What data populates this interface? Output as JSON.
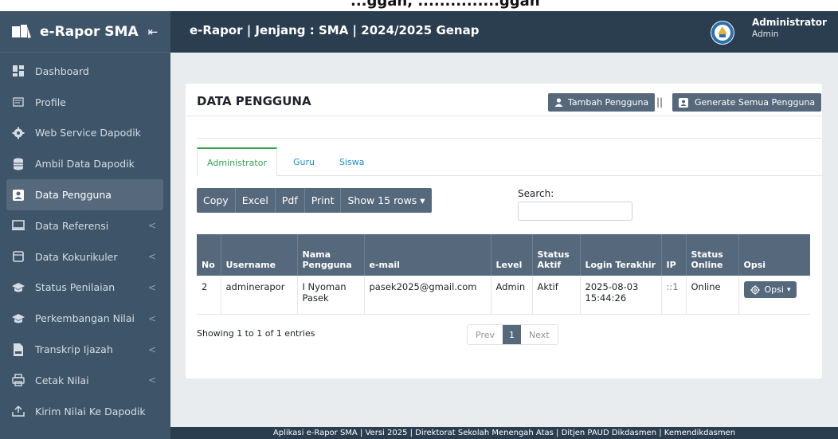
{
  "top_strip": "...ggan, ...............ggan",
  "sidebar": {
    "brand": "e-Rapor SMA",
    "collapse_icon": "⇤",
    "items": [
      {
        "label": "Dashboard",
        "icon": "dashboard-icon",
        "caret": ""
      },
      {
        "label": "Profile",
        "icon": "profile-icon",
        "caret": ""
      },
      {
        "label": "Web Service Dapodik",
        "icon": "gear-icon",
        "caret": ""
      },
      {
        "label": "Ambil Data Dapodik",
        "icon": "database-icon",
        "caret": ""
      },
      {
        "label": "Data Pengguna",
        "icon": "user-card-icon",
        "caret": ""
      },
      {
        "label": "Data Referensi",
        "icon": "monitor-icon",
        "caret": "<"
      },
      {
        "label": "Data Kokurikuler",
        "icon": "window-icon",
        "caret": "<"
      },
      {
        "label": "Status Penilaian",
        "icon": "graduation-icon",
        "caret": "<"
      },
      {
        "label": "Perkembangan Nilai",
        "icon": "graduation-icon",
        "caret": "<"
      },
      {
        "label": "Transkrip Ijazah",
        "icon": "file-icon",
        "caret": "<"
      },
      {
        "label": "Cetak Nilai",
        "icon": "printer-icon",
        "caret": "<"
      },
      {
        "label": "Kirim Nilai Ke Dapodik",
        "icon": "upload-icon",
        "caret": ""
      }
    ]
  },
  "header": {
    "title": "e-Rapor | Jenjang : SMA | 2024/2025 Genap",
    "user_name": "Administrator",
    "user_role": "Admin"
  },
  "card": {
    "title": "DATA PENGGUNA",
    "add_button": "Tambah Pengguna",
    "separator": "||",
    "generate_button": "Generate Semua Pengguna"
  },
  "tabs": [
    "Administrator",
    "Guru",
    "Siswa"
  ],
  "toolbar": [
    "Copy",
    "Excel",
    "Pdf",
    "Print",
    "Show 15 rows ▾"
  ],
  "search": {
    "label": "Search:",
    "value": ""
  },
  "table": {
    "headers": [
      "No",
      "Username",
      "Nama Pengguna",
      "e-mail",
      "Level",
      "Status Aktif",
      "Login Terakhir",
      "IP",
      "Status Online",
      "Opsi"
    ],
    "rows": [
      {
        "no": "2",
        "username": "adminerapor",
        "nama": "I Nyoman Pasek",
        "email": "pasek2025@gmail.com",
        "level": "Admin",
        "status_aktif": "Aktif",
        "login": "2025-08-03 15:44:26",
        "ip": "::1",
        "status_online": "Online",
        "opsi": "Opsi"
      }
    ]
  },
  "entries": "Showing 1 to 1 of 1 entries",
  "pagination": {
    "prev": "Prev",
    "current": "1",
    "next": "Next"
  },
  "footer": "Aplikasi e-Rapor SMA | Versi 2025 | Direktorat Sekolah Menengah Atas | Ditjen PAUD Dikdasmen | Kemendikdasmen"
}
